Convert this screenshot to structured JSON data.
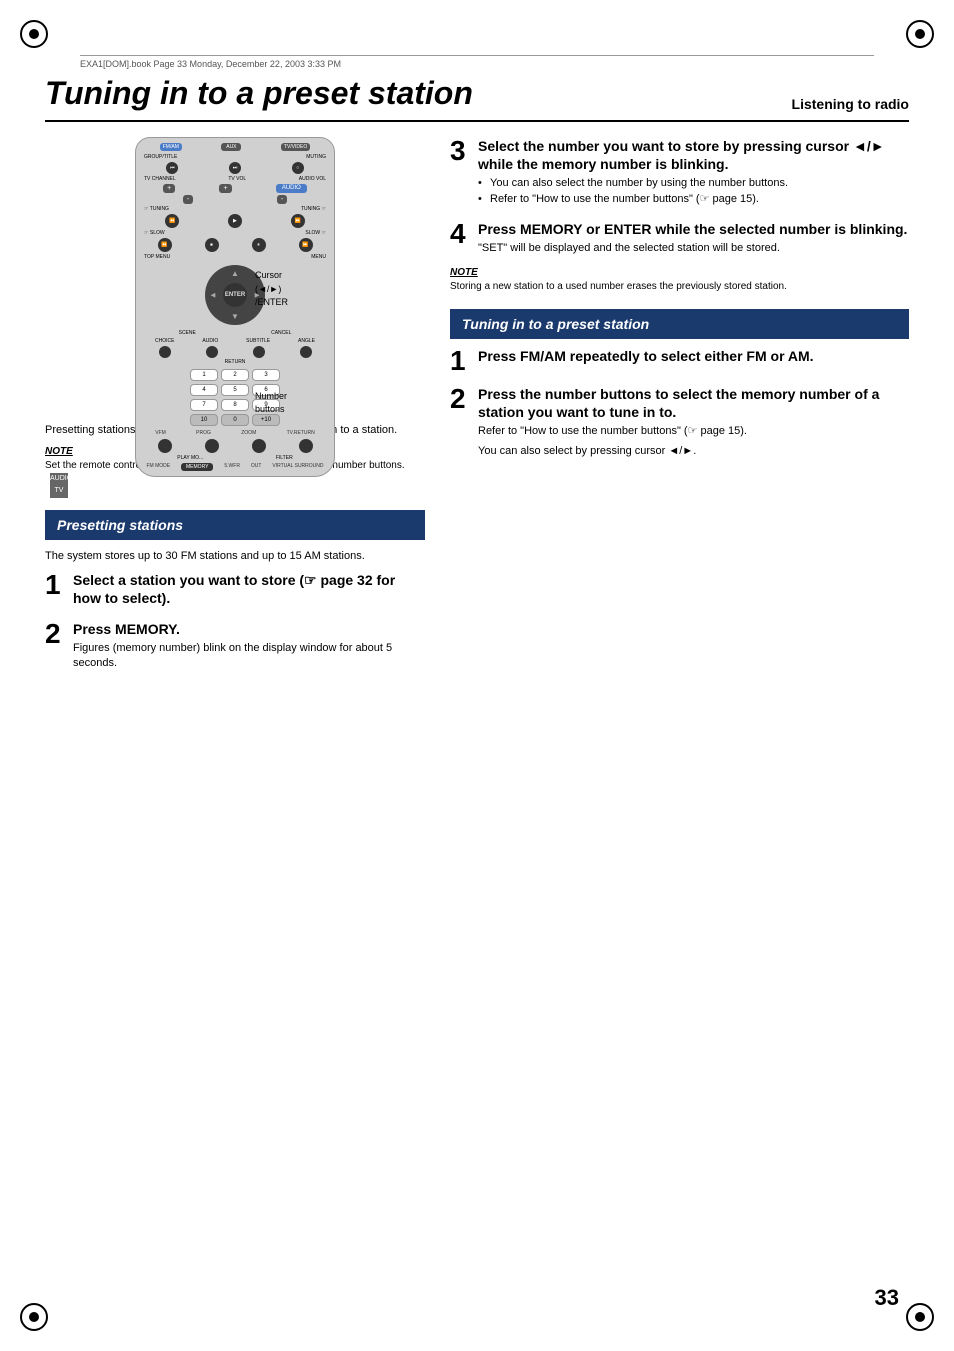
{
  "page": {
    "number": "33",
    "file_info": "EXA1[DOM].book  Page 33  Monday, December 22, 2003  3:33 PM"
  },
  "header": {
    "title": "Tuning in to a preset station",
    "subtitle": "Listening to radio"
  },
  "left_column": {
    "intro_text": "Presetting stations in the system allows you to easily tune in to a station.",
    "note1": {
      "title": "NOTE",
      "text": "Set the remote control mode selector to AUDIO before using the number buttons."
    },
    "callout_cursor": "Cursor\n(◄/►)\n/ENTER",
    "callout_number": "Number\nbuttons",
    "section_header": "Presetting stations",
    "section_body": "The system stores up to 30 FM stations and up to 15 AM stations.",
    "step1": {
      "number": "1",
      "title": "Select a station you want to store (☞ page 32 for how to select)."
    },
    "step2": {
      "number": "2",
      "title": "Press MEMORY.",
      "body": "Figures (memory number) blink on the display window for about 5 seconds."
    }
  },
  "right_column": {
    "step3": {
      "number": "3",
      "title": "Select the number you want to store by pressing cursor ◄/► while the memory number is blinking.",
      "bullets": [
        "You can also select the number by using the number buttons.",
        "Refer to \"How to use the number buttons\" (☞ page 15)."
      ]
    },
    "step4": {
      "number": "4",
      "title": "Press MEMORY or ENTER while the selected number is blinking.",
      "body": "\"SET\" will be displayed and the selected station will be stored."
    },
    "note2": {
      "title": "NOTE",
      "text": "Storing a new station to a used number erases the previously stored station."
    },
    "section_header": "Tuning in to a preset station",
    "step_r1": {
      "number": "1",
      "title": "Press FM/AM repeatedly to select either FM or AM."
    },
    "step_r2": {
      "number": "2",
      "title": "Press the number buttons to select the memory number of a station you want to tune in to.",
      "body1": "Refer to \"How to use the number buttons\" (☞ page 15).",
      "body2": "You can also select by pressing cursor ◄/►."
    }
  },
  "remote": {
    "labels": {
      "fm_am": "FM/AM",
      "aux": "AUX",
      "tv_video": "TV/VIDEO",
      "group_title": "GROUP/TITLE",
      "muting": "MUTING",
      "tv_channel": "TV CHANNEL",
      "tv_vol": "TV VOL",
      "audio_vol": "AUDIO VOL",
      "audio": "AUDIO",
      "tuning": "TUNING",
      "slow": "SLOW",
      "top_menu": "TOP MENU",
      "menu": "MENU",
      "enter": "ENTER",
      "choice": "CHOICE",
      "subtitle": "SUBTITLE",
      "angle": "ANGLE",
      "return": "RETURN",
      "memory": "MEMORY"
    },
    "num_buttons": [
      "1",
      "2",
      "3",
      "4",
      "5",
      "6",
      "7",
      "8",
      "9",
      "10",
      "+10"
    ]
  }
}
